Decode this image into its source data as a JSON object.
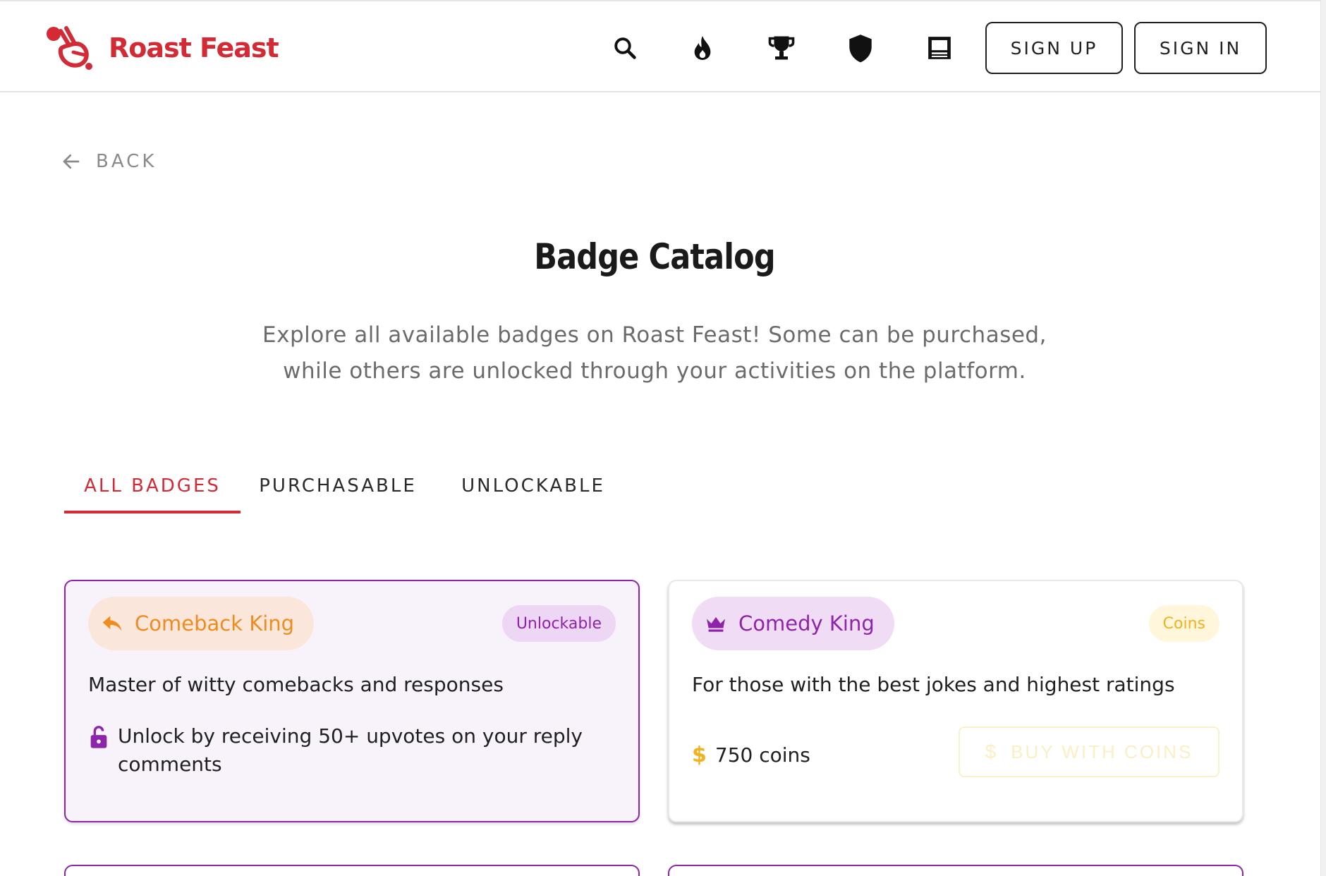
{
  "header": {
    "logo_text": "Roast Feast",
    "icons": [
      "search-icon",
      "fire-icon",
      "trophy-icon",
      "shield-icon",
      "panel-icon"
    ],
    "sign_up_label": "SIGN UP",
    "sign_in_label": "SIGN IN"
  },
  "nav": {
    "back_label": "BACK"
  },
  "page": {
    "title": "Badge Catalog",
    "subtitle_line1": "Explore all available badges on Roast Feast! Some can be purchased,",
    "subtitle_line2": "while others are unlocked through your activities on the platform."
  },
  "tabs": [
    {
      "label": "ALL BADGES",
      "active": true
    },
    {
      "label": "PURCHASABLE",
      "active": false
    },
    {
      "label": "UNLOCKABLE",
      "active": false
    }
  ],
  "badges": [
    {
      "name": "Comeback King",
      "type": "Unlockable",
      "icon": "reply-icon",
      "description": "Master of witty comebacks and responses",
      "unlock_line1": "Unlock by receiving 50+ upvotes on your reply",
      "unlock_line2": "comments"
    },
    {
      "name": "Comedy King",
      "type": "Coins",
      "icon": "crown-icon",
      "description": "For those with the best jokes and highest ratings",
      "price": "750 coins",
      "buy_label": "BUY WITH COINS"
    }
  ],
  "colors": {
    "brand": "#d42a35",
    "unlockable_accent": "#8e24aa",
    "coins_accent": "#f3b21c",
    "orange_accent": "#ef8c1e"
  }
}
